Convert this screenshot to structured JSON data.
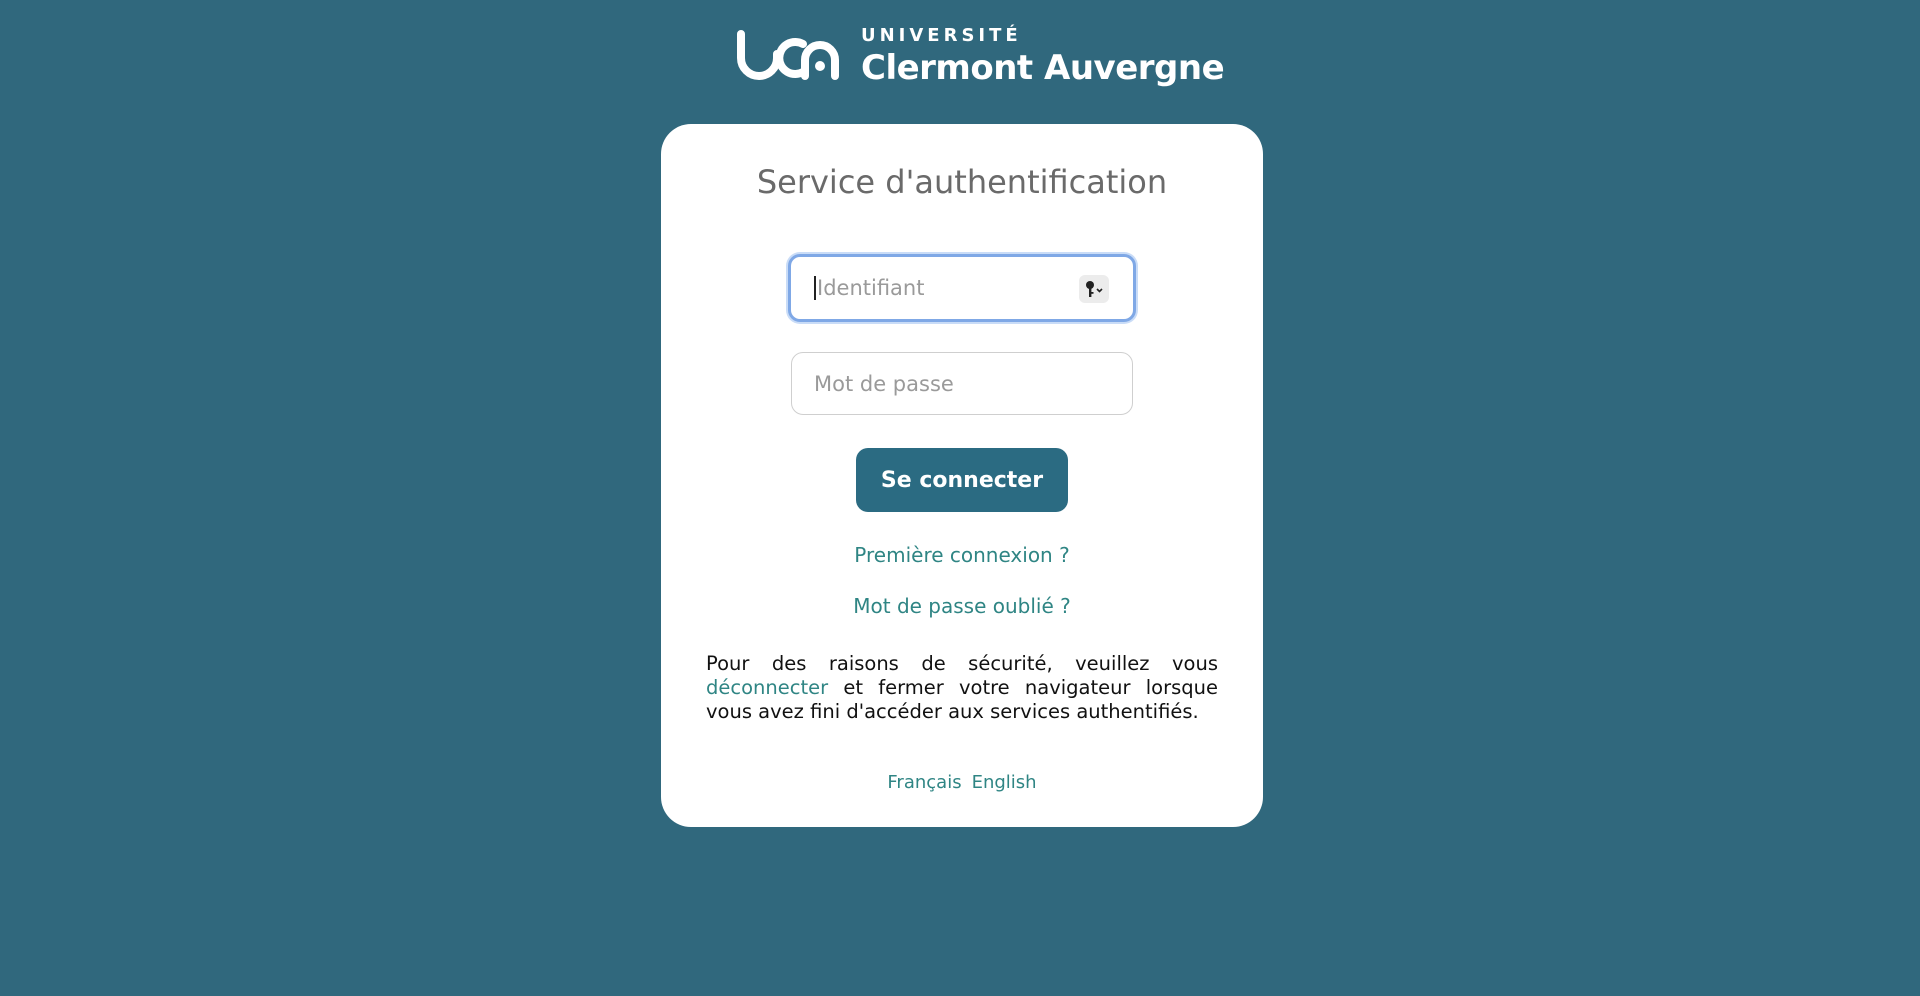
{
  "header": {
    "logo_line1": "UNIVERSITÉ",
    "logo_line2": "Clermont Auvergne"
  },
  "card": {
    "title": "Service d'authentification",
    "login_placeholder": "Identifiant",
    "password_placeholder": "Mot de passe",
    "submit_label": "Se connecter",
    "first_login_link": "Première connexion ?",
    "forgot_password_link": "Mot de passe oublié ?",
    "security_text_before": "Pour des raisons de sécurité, veuillez vous ",
    "security_link": "déconnecter",
    "security_text_after": " et fermer votre navigateur lorsque vous avez fini d'accéder aux services authentifiés."
  },
  "languages": {
    "fr": "Français",
    "en": "English"
  },
  "colors": {
    "background": "#30687d",
    "button": "#2b6b82",
    "link": "#2f8584"
  }
}
